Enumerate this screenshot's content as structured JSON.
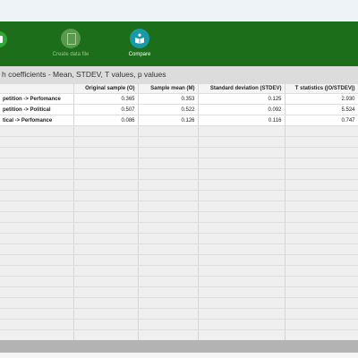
{
  "toolbar": {
    "buttons": [
      {
        "label": "Create data file",
        "icon": "file-icon",
        "enabled": false
      },
      {
        "label": "Compare",
        "icon": "book-icon",
        "enabled": true
      }
    ],
    "colors": {
      "toolbar_bg": "#1d6e1a",
      "compare_icon_bg": "#1a9aa8"
    }
  },
  "panel": {
    "title": "h coefficients - Mean, STDEV, T values, p values"
  },
  "table": {
    "columns": [
      "",
      "Original sample (O)",
      "Sample mean (M)",
      "Standard deviation (STDEV)",
      "T statistics (|O/STDEV|)"
    ],
    "rows": [
      {
        "label": "petition -> Perfomance",
        "values": [
          "0.365",
          "0.353",
          "0.125",
          "2.930"
        ]
      },
      {
        "label": "petition -> Political",
        "values": [
          "0.507",
          "0.522",
          "0.092",
          "5.524"
        ]
      },
      {
        "label": "tical -> Perfomance",
        "values": [
          "0.086",
          "0.126",
          "0.116",
          "0.747"
        ]
      }
    ]
  }
}
